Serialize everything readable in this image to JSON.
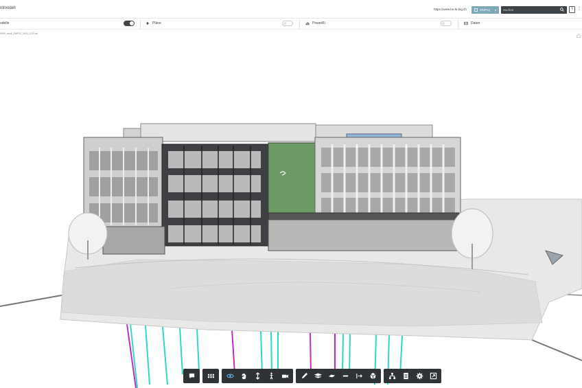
{
  "header": {
    "title": "ntmodell",
    "url": "https://www.bu-bi-big.ch",
    "model_button": "ONProj",
    "search_placeholder": "Suchen",
    "help_label": "?",
    "more_label": "⋮"
  },
  "panels": [
    {
      "label": "odelle",
      "toggle_on": true
    },
    {
      "label": "Pläne",
      "toggle_on": false
    },
    {
      "label": "PowerBI",
      "toggle_on": false
    },
    {
      "label": "Daten"
    }
  ],
  "viewport": {
    "file_name": "0005_modl_OMP42_0000_LOS.ssl"
  },
  "colors": {
    "accent": "#7fa8b8",
    "toolbar_bg": "#2f3336",
    "search_bg": "#3d4247",
    "facade_green": "#6b9a64",
    "pile_cyan": "#2fd6c8",
    "pile_magenta": "#c02bc8"
  },
  "toolbar": {
    "groups": [
      [
        "comment-icon"
      ],
      [
        "grid-menu-icon"
      ],
      [
        "orbit-icon",
        "pan-hand-icon",
        "zoom-icon",
        "walk-icon",
        "camera-icon"
      ],
      [
        "markup-pen-icon",
        "layers-icon",
        "section-plane-icon",
        "measure-icon",
        "explode-icon",
        "model-browser-icon"
      ],
      [
        "tree-structure-icon",
        "properties-icon",
        "settings-gear-icon",
        "fullscreen-icon"
      ]
    ]
  }
}
